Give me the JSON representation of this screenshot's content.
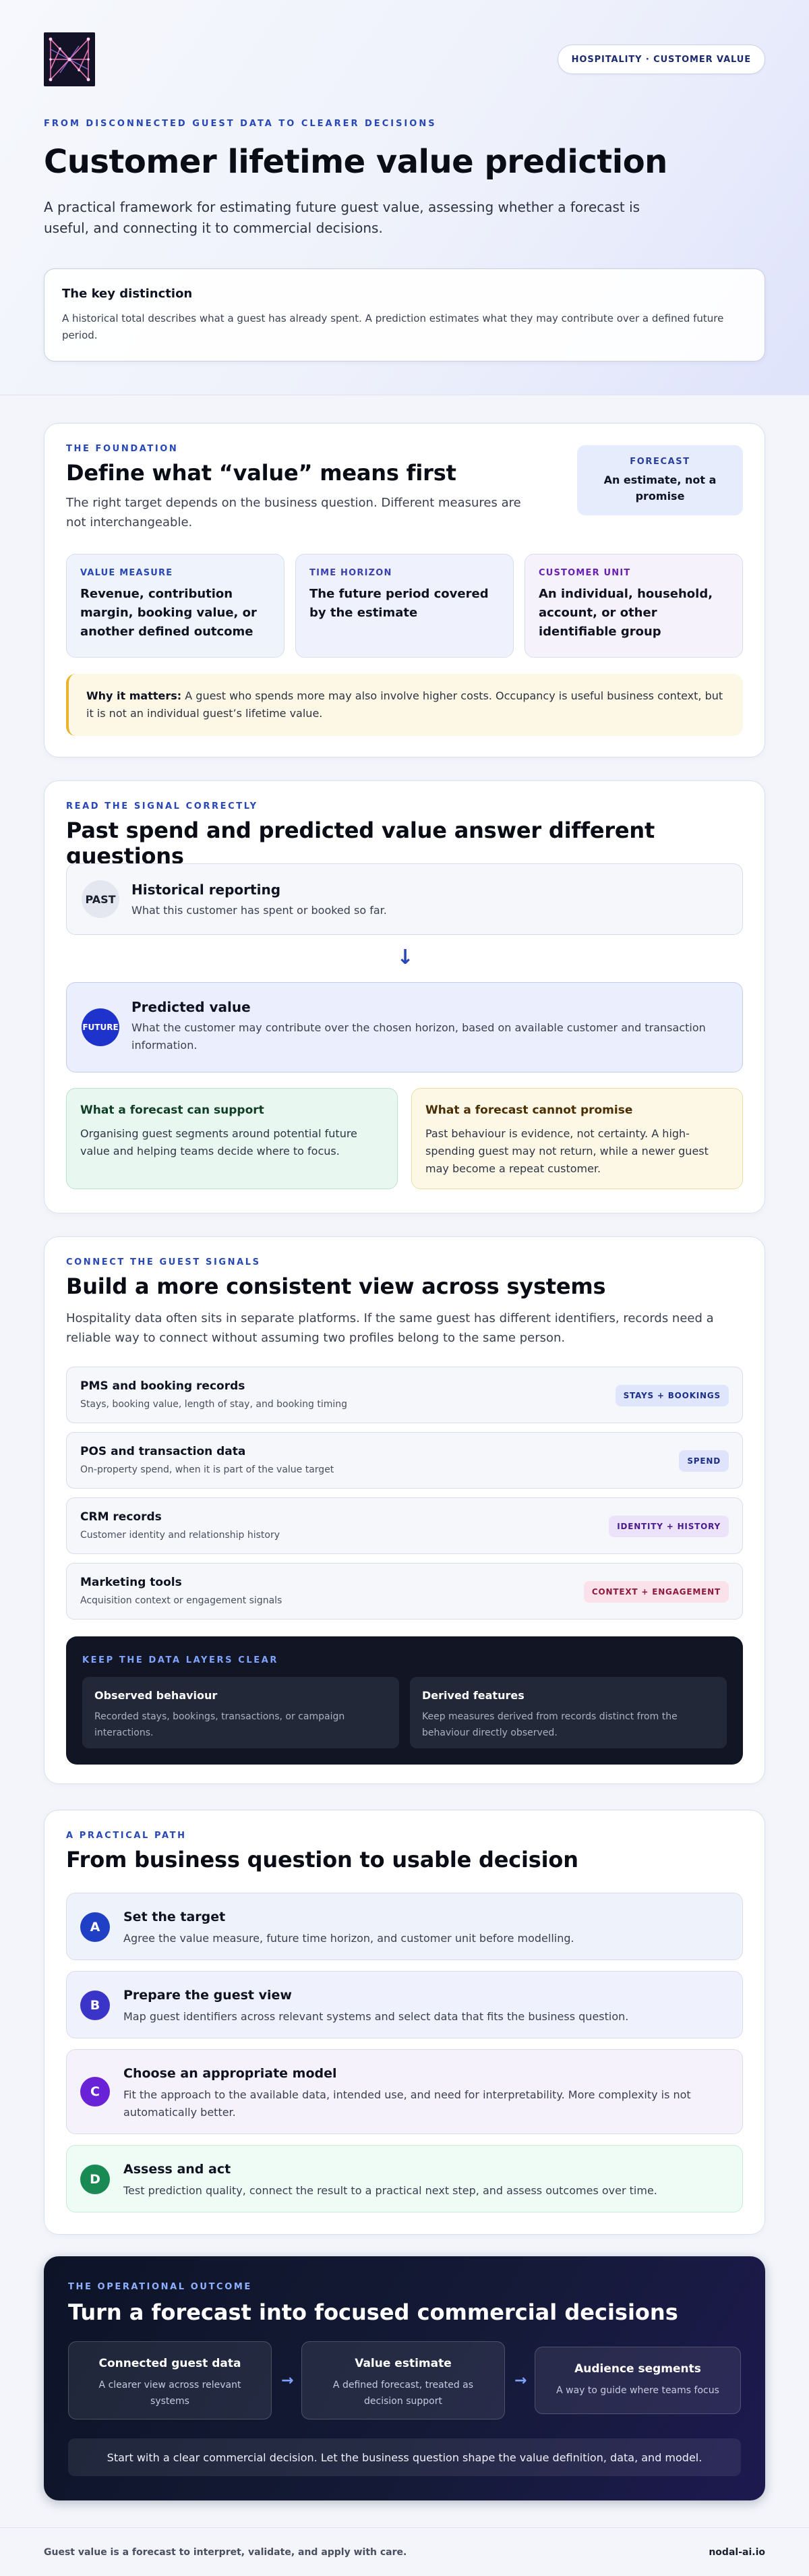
{
  "hero": {
    "badge": "HOSPITALITY · CUSTOMER VALUE",
    "eyebrow": "FROM DISCONNECTED GUEST DATA TO CLEARER DECISIONS",
    "title": "Customer lifetime value prediction",
    "subtitle": "A practical framework for estimating future guest value, assessing whether a forecast is useful, and connecting it to commercial decisions.",
    "card": {
      "title": "The key distinction",
      "text": "A historical total describes what a guest has already spent. A prediction estimates what they may contribute over a defined future period."
    }
  },
  "foundation": {
    "eyebrow": "THE FOUNDATION",
    "title": "Define what “value” means first",
    "subtitle": "The right target depends on the business question. Different measures are not interchangeable.",
    "forecast_label": "FORECAST",
    "forecast_text": "An estimate, not a promise",
    "cards": [
      {
        "label": "VALUE MEASURE",
        "text": "Revenue, contribution margin, booking value, or another defined outcome",
        "color": "#2747b8"
      },
      {
        "label": "TIME HORIZON",
        "text": "The future period covered by the estimate",
        "color": "#3c3fb0"
      },
      {
        "label": "CUSTOMER UNIT",
        "text": "An individual, household, account, or other identifiable group",
        "color": "#6a1fb3"
      }
    ],
    "why_label": "Why it matters:",
    "why_text": " A guest who spends more may also involve higher costs. Occupancy is useful business context, but it is not an individual guest’s lifetime value."
  },
  "signal": {
    "eyebrow": "READ THE SIGNAL CORRECTLY",
    "title": "Past spend and predicted value answer different questions",
    "historical": {
      "badge": "PAST",
      "title": "Historical reporting",
      "text": "What this customer has spent or booked so far."
    },
    "arrow": "↓",
    "predicted": {
      "badge": "FUTURE",
      "title": "Predicted value",
      "text": "What the customer may contribute over the chosen horizon, based on available customer and transaction information."
    },
    "can": {
      "title": "What a forecast can support",
      "text": "Organising guest segments around potential future value and helping teams decide where to focus."
    },
    "cannot": {
      "title": "What a forecast cannot promise",
      "text": "Past behaviour is evidence, not certainty. A high-spending guest may not return, while a newer guest may become a repeat customer."
    }
  },
  "signals": {
    "eyebrow": "CONNECT THE GUEST SIGNALS",
    "title": "Build a more consistent view across systems",
    "subtitle": "Hospitality data often sits in separate platforms. If the same guest has different identifiers, records need a reliable way to connect without assuming two profiles belong to the same person.",
    "systems": [
      {
        "title": "PMS and booking records",
        "text": "Stays, booking value, length of stay, and booking timing",
        "tag": "STAYS + BOOKINGS",
        "tag_bg": "#dfe6fb",
        "tag_fg": "#1c2f86"
      },
      {
        "title": "POS and transaction data",
        "text": "On-property spend, when it is part of the value target",
        "tag": "SPEND",
        "tag_bg": "#dfe3fb",
        "tag_fg": "#1c2f86"
      },
      {
        "title": "CRM records",
        "text": "Customer identity and relationship history",
        "tag": "IDENTITY + HISTORY",
        "tag_bg": "#ece3fb",
        "tag_fg": "#4a1b8f"
      },
      {
        "title": "Marketing tools",
        "text": "Acquisition context or engagement signals",
        "tag": "CONTEXT + ENGAGEMENT",
        "tag_bg": "#fbe1ea",
        "tag_fg": "#8c1a3d"
      }
    ],
    "layers_eyebrow": "KEEP THE DATA LAYERS CLEAR",
    "layers": [
      {
        "title": "Observed behaviour",
        "text": "Recorded stays, bookings, transactions, or campaign interactions."
      },
      {
        "title": "Derived features",
        "text": "Keep measures derived from records distinct from the behaviour directly observed."
      }
    ]
  },
  "path": {
    "eyebrow": "A PRACTICAL PATH",
    "title": "From business question to usable decision",
    "steps": [
      {
        "letter": "A",
        "title": "Set the target",
        "text": "Agree the value measure, future time horizon, and customer unit before modelling.",
        "color": "#1f3fc4",
        "bg": "#eef2fb"
      },
      {
        "letter": "B",
        "title": "Prepare the guest view",
        "text": "Map guest identifiers across relevant systems and select data that fits the business question.",
        "color": "#3b34c8",
        "bg": "#eff1fc"
      },
      {
        "letter": "C",
        "title": "Choose an appropriate model",
        "text": "Fit the approach to the available data, intended use, and need for interpretability. More complexity is not automatically better.",
        "color": "#6a22d6",
        "bg": "#f5f2fc"
      },
      {
        "letter": "D",
        "title": "Assess and act",
        "text": "Test prediction quality, connect the result to a practical next step, and assess outcomes over time.",
        "color": "#1a8a55",
        "bg": "#effbf5"
      }
    ]
  },
  "outcome": {
    "eyebrow": "THE OPERATIONAL OUTCOME",
    "title": "Turn a forecast into focused commercial decisions",
    "flow": [
      {
        "title": "Connected guest data",
        "text": "A clearer view across relevant systems"
      },
      {
        "title": "Value estimate",
        "text": "A defined forecast, treated as decision support"
      },
      {
        "title": "Audience segments",
        "text": "A way to guide where teams focus"
      }
    ],
    "arrow": "→",
    "bottom": "Start with a clear commercial decision. Let the business question shape the value definition, data, and model."
  },
  "footer": {
    "left": "Guest value is a forecast to interpret, validate, and apply with care.",
    "right": "nodal-ai.io"
  }
}
